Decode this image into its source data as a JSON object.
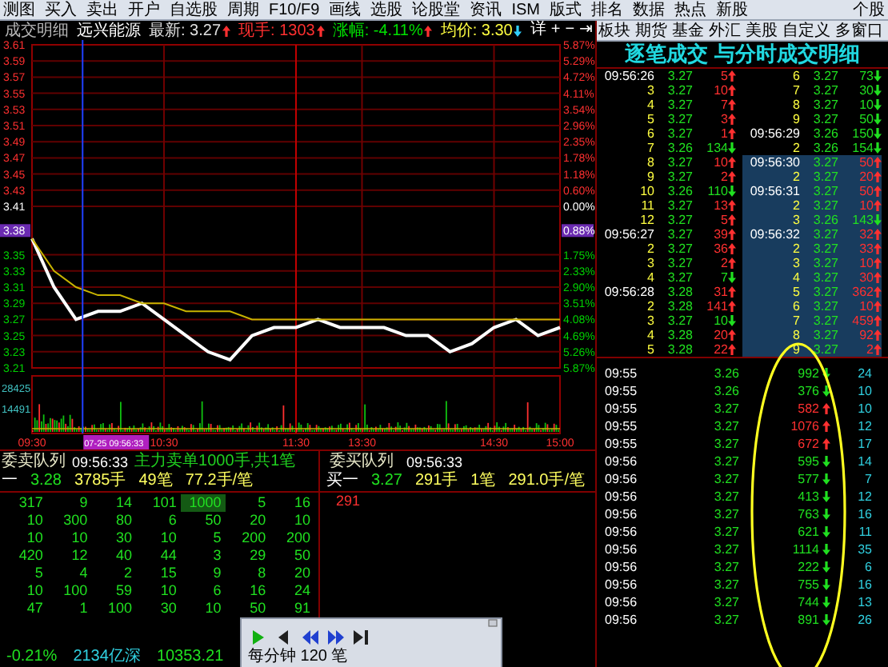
{
  "toolbar": {
    "items": [
      "测图",
      "买入",
      "卖出",
      "开户",
      "自选股",
      "周期",
      "F10/F9",
      "画线",
      "选股",
      "论股堂",
      "资讯",
      "ISM",
      "版式",
      "排名",
      "数据",
      "热点",
      "新股",
      "个股"
    ],
    "right_items": [
      "板块",
      "期货",
      "基金",
      "外汇",
      "美股",
      "自定义",
      "多窗口"
    ]
  },
  "chart_header": {
    "title": "成交明细",
    "stock": "远兴能源",
    "fields": [
      {
        "kind": "last",
        "text": "最新: 3.27",
        "rising": true
      },
      {
        "kind": "volume",
        "text": "现手: 1303",
        "rising": true
      },
      {
        "kind": "change",
        "text": "涨幅: -4.11%",
        "rising": true
      },
      {
        "kind": "average",
        "text": "均价: 3.30",
        "rising": false
      }
    ],
    "controls": [
      "详",
      "+",
      "−",
      "⇥"
    ]
  },
  "chart": {
    "chart_data": {
      "type": "line",
      "categories": [
        "09:30",
        null,
        null,
        null,
        null,
        null,
        "10:30",
        null,
        null,
        null,
        null,
        null,
        "11:30",
        null,
        null,
        "13:30",
        null,
        null,
        null,
        null,
        null,
        "14:30",
        null,
        null,
        "15:00"
      ],
      "series": [
        {
          "color": "#ffffff",
          "values": [
            3.37,
            3.31,
            3.27,
            3.28,
            3.28,
            3.29,
            3.27,
            3.25,
            3.23,
            3.22,
            3.25,
            3.26,
            3.26,
            3.27,
            3.26,
            3.26,
            3.26,
            3.25,
            3.25,
            3.23,
            3.24,
            3.26,
            3.27,
            3.25,
            3.26
          ]
        },
        {
          "color": "#c8b400",
          "values": [
            3.37,
            3.33,
            3.31,
            3.3,
            3.3,
            3.29,
            3.29,
            3.28,
            3.28,
            3.28,
            3.27,
            3.27,
            3.27,
            3.27,
            3.27,
            3.27,
            3.27,
            3.27,
            3.27,
            3.27,
            3.27,
            3.27,
            3.27,
            3.27,
            3.27
          ]
        }
      ],
      "ylim": [
        3.21,
        3.61
      ],
      "grid": true,
      "yticks": [
        3.61,
        3.59,
        3.57,
        3.55,
        3.53,
        3.51,
        3.49,
        3.47,
        3.45,
        3.43,
        3.41,
        3.35,
        3.33,
        3.31,
        3.29,
        3.27,
        3.25,
        3.23,
        3.21
      ]
    },
    "right_axis_labels": [
      "5.87%",
      "5.29%",
      "4.72%",
      "4.11%",
      "3.54%",
      "2.96%",
      "2.35%",
      "1.78%",
      "1.18%",
      "0.60%",
      "0.00%",
      "1.75%",
      "2.33%",
      "2.90%",
      "3.51%",
      "4.08%",
      "4.69%",
      "5.26%",
      "5.87%"
    ],
    "volume_axis_labels": [
      "28425",
      "14491"
    ],
    "crosshair": {
      "price_label": "3.38",
      "percent_label": "0.88%",
      "time_label": "07-25 09:56:33"
    }
  },
  "sell_queue": {
    "title": "委卖队列",
    "time": "09:56:33",
    "note": "主力卖单1000手,共1笔",
    "best": {
      "label": "一",
      "price": "3.28",
      "volume": "3785手",
      "orders": "49笔",
      "average": "77.2手/笔"
    },
    "orders": [
      [
        {
          "text": "317",
          "highlighted": false
        },
        {
          "text": "9",
          "highlighted": false
        },
        {
          "text": "14",
          "highlighted": false
        },
        {
          "text": "101",
          "highlighted": false
        },
        {
          "text": "1000",
          "highlighted": true
        },
        {
          "text": "5",
          "highlighted": false
        },
        {
          "text": "16",
          "highlighted": false
        }
      ],
      [
        {
          "text": "10",
          "highlighted": false
        },
        {
          "text": "300",
          "highlighted": false
        },
        {
          "text": "80",
          "highlighted": false
        },
        {
          "text": "6",
          "highlighted": false
        },
        {
          "text": "50",
          "highlighted": false
        },
        {
          "text": "20",
          "highlighted": false
        },
        {
          "text": "10",
          "highlighted": false
        }
      ],
      [
        {
          "text": "10",
          "highlighted": false
        },
        {
          "text": "10",
          "highlighted": false
        },
        {
          "text": "30",
          "highlighted": false
        },
        {
          "text": "10",
          "highlighted": false
        },
        {
          "text": "5",
          "highlighted": false
        },
        {
          "text": "200",
          "highlighted": false
        },
        {
          "text": "200",
          "highlighted": false
        }
      ],
      [
        {
          "text": "420",
          "highlighted": false
        },
        {
          "text": "12",
          "highlighted": false
        },
        {
          "text": "40",
          "highlighted": false
        },
        {
          "text": "44",
          "highlighted": false
        },
        {
          "text": "3",
          "highlighted": false
        },
        {
          "text": "29",
          "highlighted": false
        },
        {
          "text": "50",
          "highlighted": false
        }
      ],
      [
        {
          "text": "5",
          "highlighted": false
        },
        {
          "text": "4",
          "highlighted": false
        },
        {
          "text": "2",
          "highlighted": false
        },
        {
          "text": "15",
          "highlighted": false
        },
        {
          "text": "9",
          "highlighted": false
        },
        {
          "text": "8",
          "highlighted": false
        },
        {
          "text": "20",
          "highlighted": false
        }
      ],
      [
        {
          "text": "10",
          "highlighted": false
        },
        {
          "text": "100",
          "highlighted": false
        },
        {
          "text": "59",
          "highlighted": false
        },
        {
          "text": "10",
          "highlighted": false
        },
        {
          "text": "6",
          "highlighted": false
        },
        {
          "text": "16",
          "highlighted": false
        },
        {
          "text": "24",
          "highlighted": false
        }
      ],
      [
        {
          "text": "47",
          "highlighted": false
        },
        {
          "text": "1",
          "highlighted": false
        },
        {
          "text": "100",
          "highlighted": false
        },
        {
          "text": "30",
          "highlighted": false
        },
        {
          "text": "10",
          "highlighted": false
        },
        {
          "text": "50",
          "highlighted": false
        },
        {
          "text": "91",
          "highlighted": false
        }
      ]
    ]
  },
  "buy_queue": {
    "title": "委买队列",
    "time": "09:56:33",
    "best": {
      "label": "买一",
      "price": "3.27",
      "volume": "291手",
      "orders": "1笔",
      "average": "291.0手/笔"
    },
    "orders": [
      "291"
    ]
  },
  "footer": {
    "change": "-0.21%",
    "turnover": "2134亿深",
    "index": "10353.21"
  },
  "playback_popup": {
    "text": "每分钟 120 笔"
  },
  "tick_detail": {
    "title": "逐笔成交 与分时成交明细",
    "columns": [
      [
        {
          "kind": "time",
          "seq": "09:56:26",
          "price": "3.27",
          "volume": "5",
          "rising": true,
          "highlighted": false
        },
        {
          "kind": "seq",
          "seq": "3",
          "price": "3.27",
          "volume": "10",
          "rising": true,
          "highlighted": false
        },
        {
          "kind": "seq",
          "seq": "4",
          "price": "3.27",
          "volume": "7",
          "rising": true,
          "highlighted": false
        },
        {
          "kind": "seq",
          "seq": "5",
          "price": "3.27",
          "volume": "3",
          "rising": true,
          "highlighted": false
        },
        {
          "kind": "seq",
          "seq": "6",
          "price": "3.27",
          "volume": "1",
          "rising": true,
          "highlighted": false
        },
        {
          "kind": "seq",
          "seq": "7",
          "price": "3.26",
          "volume": "134",
          "rising": false,
          "highlighted": false
        },
        {
          "kind": "seq",
          "seq": "8",
          "price": "3.27",
          "volume": "10",
          "rising": true,
          "highlighted": false
        },
        {
          "kind": "seq",
          "seq": "9",
          "price": "3.27",
          "volume": "2",
          "rising": true,
          "highlighted": false
        },
        {
          "kind": "seq",
          "seq": "10",
          "price": "3.26",
          "volume": "110",
          "rising": false,
          "highlighted": false
        },
        {
          "kind": "seq",
          "seq": "11",
          "price": "3.27",
          "volume": "13",
          "rising": true,
          "highlighted": false
        },
        {
          "kind": "seq",
          "seq": "12",
          "price": "3.27",
          "volume": "5",
          "rising": true,
          "highlighted": false
        },
        {
          "kind": "time",
          "seq": "09:56:27",
          "price": "3.27",
          "volume": "39",
          "rising": true,
          "highlighted": false
        },
        {
          "kind": "seq",
          "seq": "2",
          "price": "3.27",
          "volume": "36",
          "rising": true,
          "highlighted": false
        },
        {
          "kind": "seq",
          "seq": "3",
          "price": "3.27",
          "volume": "2",
          "rising": true,
          "highlighted": false
        },
        {
          "kind": "seq",
          "seq": "4",
          "price": "3.27",
          "volume": "7",
          "rising": false,
          "highlighted": false
        },
        {
          "kind": "time",
          "seq": "09:56:28",
          "price": "3.28",
          "volume": "31",
          "rising": true,
          "highlighted": false
        },
        {
          "kind": "seq",
          "seq": "2",
          "price": "3.28",
          "volume": "141",
          "rising": true,
          "highlighted": false
        },
        {
          "kind": "seq",
          "seq": "3",
          "price": "3.27",
          "volume": "10",
          "rising": false,
          "highlighted": false
        },
        {
          "kind": "seq",
          "seq": "4",
          "price": "3.28",
          "volume": "20",
          "rising": true,
          "highlighted": false
        },
        {
          "kind": "seq",
          "seq": "5",
          "price": "3.28",
          "volume": "22",
          "rising": true,
          "highlighted": false
        }
      ],
      [
        {
          "kind": "seq",
          "seq": "6",
          "price": "3.27",
          "volume": "73",
          "rising": false,
          "highlighted": false
        },
        {
          "kind": "seq",
          "seq": "7",
          "price": "3.27",
          "volume": "30",
          "rising": false,
          "highlighted": false
        },
        {
          "kind": "seq",
          "seq": "8",
          "price": "3.27",
          "volume": "10",
          "rising": false,
          "highlighted": false
        },
        {
          "kind": "seq",
          "seq": "9",
          "price": "3.27",
          "volume": "50",
          "rising": false,
          "highlighted": false
        },
        {
          "kind": "time",
          "seq": "09:56:29",
          "price": "3.26",
          "volume": "150",
          "rising": false,
          "highlighted": false
        },
        {
          "kind": "seq",
          "seq": "2",
          "price": "3.26",
          "volume": "154",
          "rising": false,
          "highlighted": false
        },
        {
          "kind": "time",
          "seq": "09:56:30",
          "price": "3.27",
          "volume": "50",
          "rising": true,
          "highlighted": true
        },
        {
          "kind": "seq",
          "seq": "2",
          "price": "3.27",
          "volume": "20",
          "rising": true,
          "highlighted": true
        },
        {
          "kind": "time",
          "seq": "09:56:31",
          "price": "3.27",
          "volume": "50",
          "rising": true,
          "highlighted": true
        },
        {
          "kind": "seq",
          "seq": "2",
          "price": "3.27",
          "volume": "10",
          "rising": true,
          "highlighted": true
        },
        {
          "kind": "seq",
          "seq": "3",
          "price": "3.26",
          "volume": "143",
          "rising": false,
          "highlighted": true
        },
        {
          "kind": "time",
          "seq": "09:56:32",
          "price": "3.27",
          "volume": "32",
          "rising": true,
          "highlighted": true
        },
        {
          "kind": "seq",
          "seq": "2",
          "price": "3.27",
          "volume": "33",
          "rising": true,
          "highlighted": true
        },
        {
          "kind": "seq",
          "seq": "3",
          "price": "3.27",
          "volume": "10",
          "rising": true,
          "highlighted": true
        },
        {
          "kind": "seq",
          "seq": "4",
          "price": "3.27",
          "volume": "30",
          "rising": true,
          "highlighted": true
        },
        {
          "kind": "seq",
          "seq": "5",
          "price": "3.27",
          "volume": "362",
          "rising": true,
          "highlighted": true
        },
        {
          "kind": "seq",
          "seq": "6",
          "price": "3.27",
          "volume": "10",
          "rising": true,
          "highlighted": true
        },
        {
          "kind": "seq",
          "seq": "7",
          "price": "3.27",
          "volume": "459",
          "rising": true,
          "highlighted": true
        },
        {
          "kind": "seq",
          "seq": "8",
          "price": "3.27",
          "volume": "92",
          "rising": true,
          "highlighted": true
        },
        {
          "kind": "seq",
          "seq": "9",
          "price": "3.27",
          "volume": "2",
          "rising": true,
          "highlighted": true
        }
      ]
    ]
  },
  "minute_detail": {
    "rows": [
      {
        "time": "09:55",
        "price": "3.26",
        "volume": "992",
        "rising": false,
        "count": "24"
      },
      {
        "time": "09:55",
        "price": "3.26",
        "volume": "376",
        "rising": false,
        "count": "10"
      },
      {
        "time": "09:55",
        "price": "3.27",
        "volume": "582",
        "rising": true,
        "count": "10"
      },
      {
        "time": "09:55",
        "price": "3.27",
        "volume": "1076",
        "rising": true,
        "count": "12"
      },
      {
        "time": "09:55",
        "price": "3.27",
        "volume": "672",
        "rising": true,
        "count": "17"
      },
      {
        "time": "09:56",
        "price": "3.27",
        "volume": "595",
        "rising": false,
        "count": "14"
      },
      {
        "time": "09:56",
        "price": "3.27",
        "volume": "577",
        "rising": false,
        "count": "7"
      },
      {
        "time": "09:56",
        "price": "3.27",
        "volume": "413",
        "rising": false,
        "count": "12"
      },
      {
        "time": "09:56",
        "price": "3.27",
        "volume": "763",
        "rising": false,
        "count": "16"
      },
      {
        "time": "09:56",
        "price": "3.27",
        "volume": "621",
        "rising": false,
        "count": "11"
      },
      {
        "time": "09:56",
        "price": "3.27",
        "volume": "1114",
        "rising": false,
        "count": "35"
      },
      {
        "time": "09:56",
        "price": "3.27",
        "volume": "222",
        "rising": false,
        "count": "6"
      },
      {
        "time": "09:56",
        "price": "3.27",
        "volume": "755",
        "rising": false,
        "count": "16"
      },
      {
        "time": "09:56",
        "price": "3.27",
        "volume": "744",
        "rising": false,
        "count": "13"
      },
      {
        "time": "09:56",
        "price": "3.27",
        "volume": "891",
        "rising": false,
        "count": "26"
      }
    ]
  }
}
